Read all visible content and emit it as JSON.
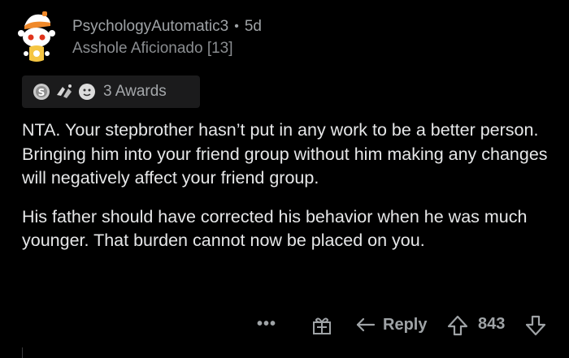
{
  "comment": {
    "username": "PsychologyAutomatic3",
    "separator": "•",
    "age": "5d",
    "flair": "Asshole Aficionado [13]",
    "awards_label": "3 Awards",
    "award_icons": [
      "silver-award-icon",
      "helpful-hands-award-icon",
      "wholesome-award-icon"
    ],
    "paragraphs": [
      "NTA. Your stepbrother hasn’t put in any work to be a better person. Bringing him into your friend group without him making any changes will negatively affect your friend group.",
      "His father should have corrected his behavior when he was much younger. That burden cannot now be placed on you."
    ]
  },
  "actions": {
    "more_label": "•••",
    "reply_label": "Reply",
    "score": "843"
  },
  "colors": {
    "background": "#000000",
    "text": "#e6e7e8",
    "meta": "#9fa3a6",
    "awards_bg": "#1b1b1c"
  }
}
